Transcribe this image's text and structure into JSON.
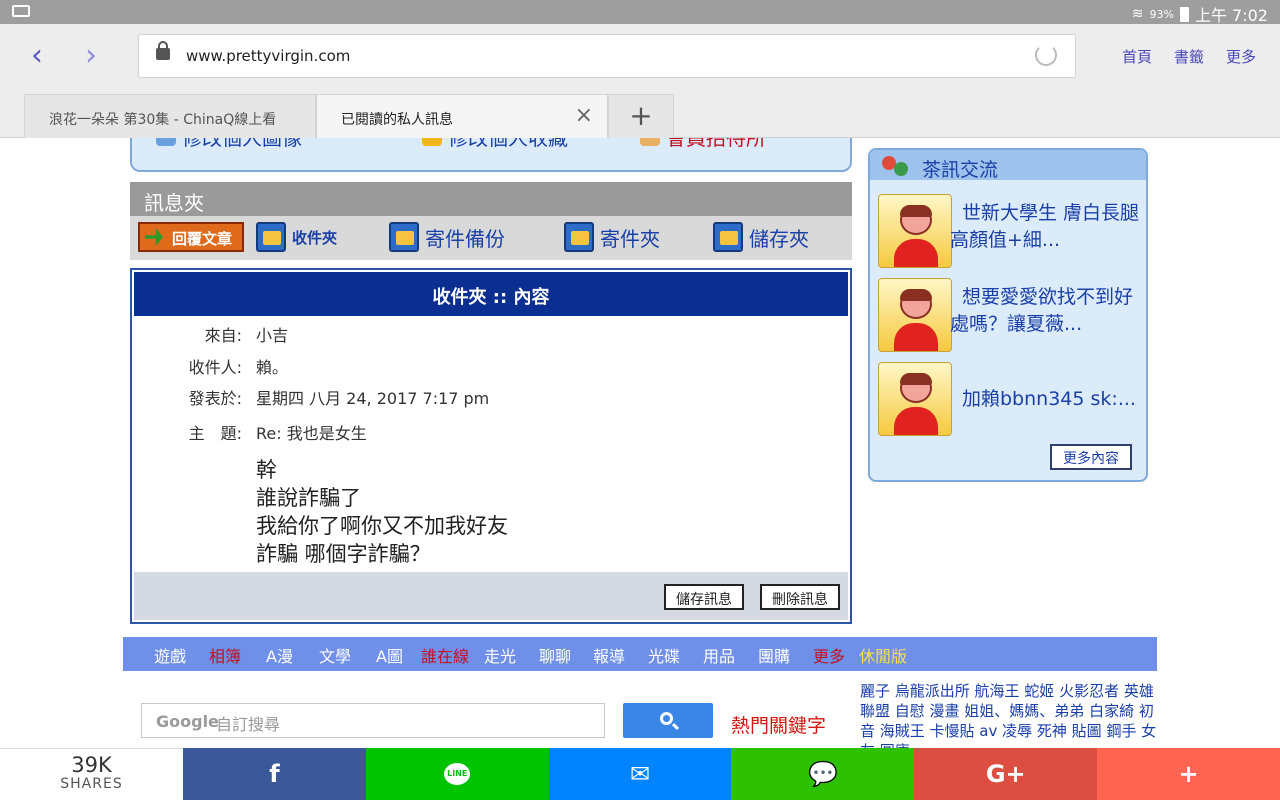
{
  "status": {
    "battery": "93%",
    "time": "上午 7:02"
  },
  "browser": {
    "url": "www.prettyvirgin.com",
    "links": [
      "首頁",
      "書籤",
      "更多"
    ],
    "tabs": [
      "浪花一朵朵 第30集 - ChinaQ線上看",
      "已閱讀的私人訊息"
    ]
  },
  "topcut": {
    "items": [
      "修改個人圖像",
      "修改個人收藏",
      "會員招待所"
    ]
  },
  "messages": {
    "header": "訊息夾",
    "reply_label": "回覆文章",
    "folders": [
      "收件夾",
      "寄件備份",
      "寄件夾",
      "儲存夾"
    ],
    "title": "收件夾 :: 內容",
    "from_label": "來自:",
    "from": "小吉",
    "to_label": "收件人:",
    "to": "賴。",
    "date_label": "發表於:",
    "date": "星期四 八月 24, 2017 7:17 pm",
    "subject_label": "主　題:",
    "subject": "Re: 我也是女生",
    "body": [
      "幹",
      "誰說詐騙了",
      "我給你了啊你又不加我好友",
      "詐騙 哪個字詐騙？"
    ],
    "save_btn": "儲存訊息",
    "delete_btn": "刪除訊息"
  },
  "side": {
    "title": "茶訊交流",
    "entries": [
      "世新大學生 膚白長腿高顏值+細...",
      "想要愛愛欲找不到好處嗎？讓夏薇...",
      "加賴bbnn345 sk:..."
    ],
    "more": "更多內容"
  },
  "categories": [
    {
      "label": "遊戲",
      "color": "white"
    },
    {
      "label": "相簿",
      "color": "red"
    },
    {
      "label": "A漫",
      "color": "white"
    },
    {
      "label": "文學",
      "color": "white"
    },
    {
      "label": "A圖",
      "color": "white"
    },
    {
      "label": "誰在線",
      "color": "red"
    },
    {
      "label": "走光",
      "color": "white"
    },
    {
      "label": "聊聊",
      "color": "white"
    },
    {
      "label": "報導",
      "color": "white"
    },
    {
      "label": "光碟",
      "color": "white"
    },
    {
      "label": "用品",
      "color": "white"
    },
    {
      "label": "團購",
      "color": "white"
    },
    {
      "label": "更多",
      "color": "red"
    },
    {
      "label": "休閒版",
      "color": "yellow"
    }
  ],
  "search": {
    "brand": "Google",
    "placeholder": "自訂搜尋",
    "hot": "熱門關鍵字"
  },
  "tags": "麗子 烏龍派出所 航海王 蛇姬 火影忍者 英雄聯盟 自慰 漫畫 姐姐、媽媽、弟弟 白家綺 初音 海賊王 卡慢貼 av 凌辱 死神 貼圖 鋼手 女友 圖庫",
  "share": {
    "count": "39K",
    "label": "SHARES",
    "buttons": [
      {
        "name": "facebook",
        "glyph": "f",
        "color": "#3b5998"
      },
      {
        "name": "line",
        "glyph": "LINE",
        "color": "#00c300"
      },
      {
        "name": "messenger",
        "glyph": "✉",
        "color": "#0084ff"
      },
      {
        "name": "wechat",
        "glyph": "💬",
        "color": "#2dc100"
      },
      {
        "name": "google-plus",
        "glyph": "G+",
        "color": "#dc4e41"
      },
      {
        "name": "more",
        "glyph": "+",
        "color": "#ff6550"
      }
    ]
  }
}
